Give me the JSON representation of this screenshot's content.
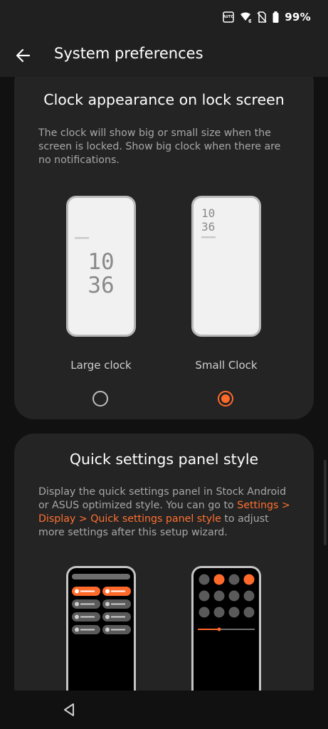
{
  "status_bar": {
    "battery_text": "99%",
    "icons": [
      "auto-brightness-icon",
      "wifi-calling-icon",
      "no-sim-icon",
      "battery-icon"
    ]
  },
  "app_bar": {
    "title": "System preferences",
    "back_icon": "arrow-left-icon"
  },
  "clock_card": {
    "title": "Clock appearance on lock screen",
    "description": "The clock will show big or small size when the screen is locked. Show big clock when there are no notifications.",
    "options": [
      {
        "label": "Large clock",
        "selected": false,
        "hour": "10",
        "minute": "36"
      },
      {
        "label": "Small Clock",
        "selected": true,
        "hour": "10",
        "minute": "36"
      }
    ]
  },
  "qs_card": {
    "title": "Quick settings panel style",
    "description_before": "Display the quick settings panel in Stock Android or ASUS optimized style. You can go to ",
    "description_link": "Settings > Display > Quick settings panel style",
    "description_after": " to adjust more settings after this setup wizard."
  },
  "colors": {
    "accent": "#ff6a2b",
    "card_bg": "#242424",
    "page_bg": "#111111",
    "bar_bg": "#202020"
  },
  "nav_bar": {
    "back_icon": "triangle-back-icon"
  }
}
